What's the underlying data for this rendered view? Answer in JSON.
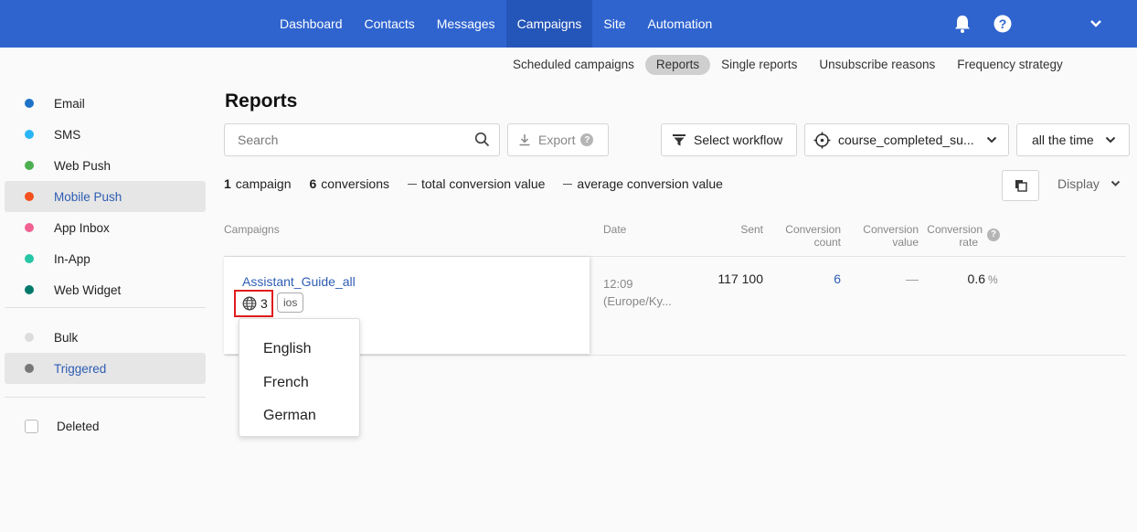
{
  "nav": {
    "items": [
      {
        "label": "Dashboard",
        "name": "nav-dashboard"
      },
      {
        "label": "Contacts",
        "name": "nav-contacts"
      },
      {
        "label": "Messages",
        "name": "nav-messages"
      },
      {
        "label": "Campaigns",
        "name": "nav-campaigns",
        "active": true
      },
      {
        "label": "Site",
        "name": "nav-site"
      },
      {
        "label": "Automation",
        "name": "nav-automation"
      }
    ]
  },
  "subnav": {
    "items": [
      {
        "label": "Scheduled campaigns"
      },
      {
        "label": "Reports",
        "active": true
      },
      {
        "label": "Single reports"
      },
      {
        "label": "Unsubscribe reasons"
      },
      {
        "label": "Frequency strategy"
      }
    ]
  },
  "sidebar": {
    "channels": [
      {
        "label": "Email",
        "color": "#1e73c8"
      },
      {
        "label": "SMS",
        "color": "#29b6f6"
      },
      {
        "label": "Web Push",
        "color": "#4caf50"
      },
      {
        "label": "Mobile Push",
        "color": "#f4511e",
        "active": true
      },
      {
        "label": "App Inbox",
        "color": "#f06292"
      },
      {
        "label": "In-App",
        "color": "#26c6a6"
      },
      {
        "label": "Web Widget",
        "color": "#00796b"
      }
    ],
    "types": [
      {
        "label": "Bulk",
        "color": "#dddddd"
      },
      {
        "label": "Triggered",
        "color": "#777777",
        "active": true
      }
    ],
    "deleted_label": "Deleted"
  },
  "page": {
    "title": "Reports",
    "search_placeholder": "Search",
    "export_label": "Export",
    "select_workflow_label": "Select workflow",
    "event_filter_value": "course_completed_su...",
    "period_value": "all the time",
    "display_label": "Display"
  },
  "stats": {
    "campaign_count": "1",
    "campaign_label": "campaign",
    "conversion_count": "6",
    "conversion_label": "conversions",
    "total_value_label": "total conversion value",
    "average_value_label": "average conversion value"
  },
  "table": {
    "headers": {
      "campaigns": "Campaigns",
      "date": "Date",
      "sent": "Sent",
      "conv_count_1": "Conversion",
      "conv_count_2": "count",
      "conv_value_1": "Conversion",
      "conv_value_2": "value",
      "conv_rate_1": "Conversion",
      "conv_rate_2": "rate"
    },
    "row": {
      "name": "Assistant_Guide_all",
      "languages_count": "3",
      "os_tag": "ios",
      "time": "12:09",
      "timezone": "(Europe/Ky...",
      "sent": "117 100",
      "conversion_count": "6",
      "conversion_value": "—",
      "conversion_rate": "0.6",
      "rate_unit": "%"
    }
  },
  "language_dropdown": {
    "options": [
      "English",
      "French",
      "German"
    ]
  },
  "colors": {
    "topbar": "#2f64cf",
    "link": "#2e5db3",
    "highlight": "#e01c1c"
  }
}
